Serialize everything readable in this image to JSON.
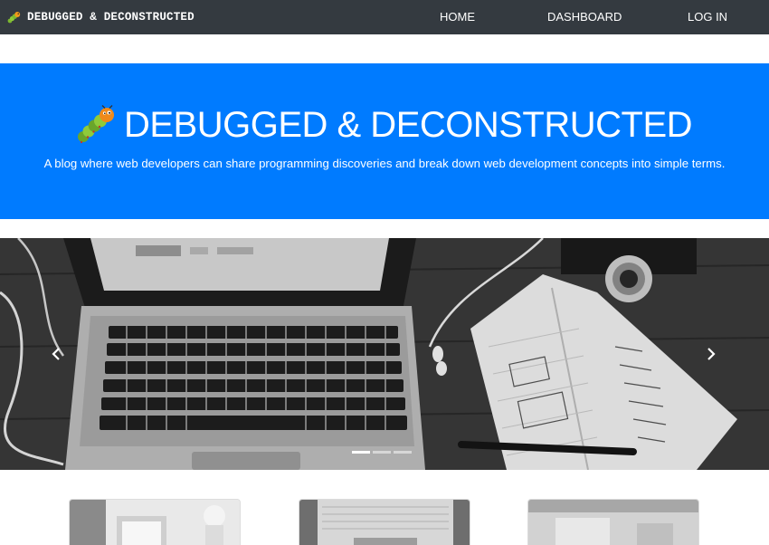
{
  "navbar": {
    "brand": "DEBUGGED & DECONSTRUCTED",
    "brand_icon": "caterpillar-bug-icon",
    "links": [
      {
        "label": "HOME"
      },
      {
        "label": "DASHBOARD"
      },
      {
        "label": "LOG IN"
      }
    ]
  },
  "hero": {
    "title": "DEBUGGED & DECONSTRUCTED",
    "subtitle": "A blog where web developers can share programming discoveries and break down web development concepts into simple terms.",
    "icon": "caterpillar-bug-icon",
    "background": "#007bff"
  },
  "carousel": {
    "slide_count": 3,
    "active_index": 0,
    "prev_icon": "chevron-left-icon",
    "next_icon": "chevron-right-icon"
  },
  "colors": {
    "navbar_bg": "#343a40",
    "accent": "#007bff"
  }
}
